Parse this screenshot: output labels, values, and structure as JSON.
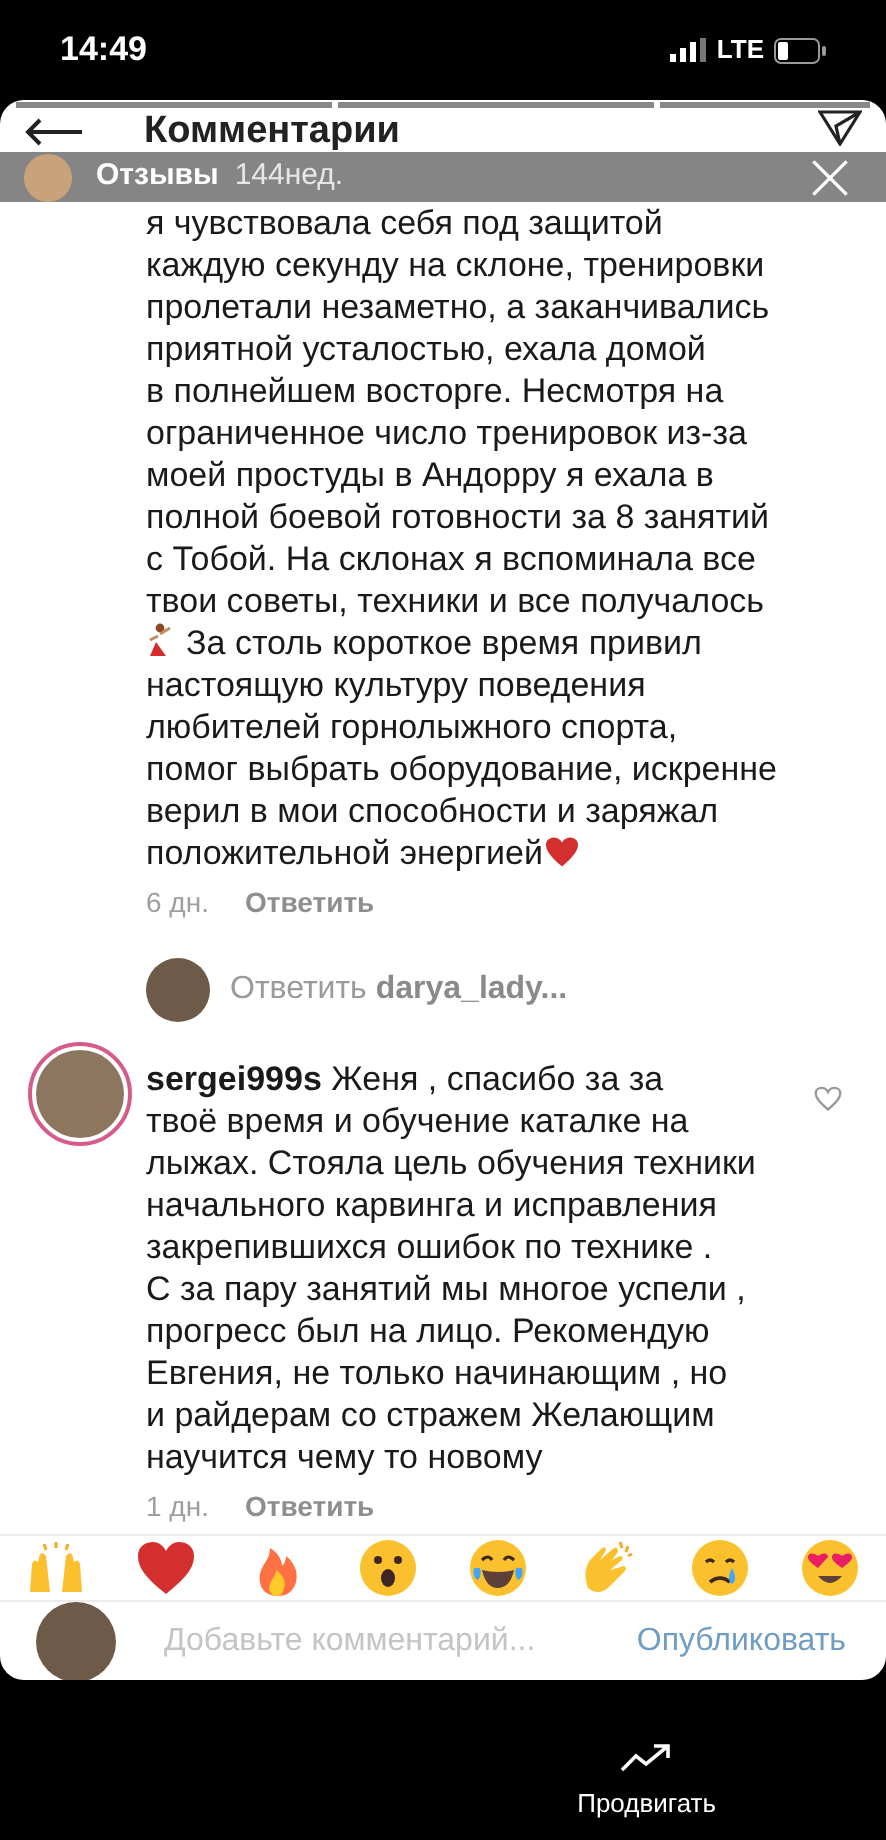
{
  "status_bar": {
    "time": "14:49",
    "network": "LTE"
  },
  "header": {
    "title": "Комментарии"
  },
  "story_overlay": {
    "author": "Отзывы",
    "age": "144нед.",
    "progress": [
      {
        "level": 1
      },
      {
        "level": 1
      },
      {
        "level": 1
      }
    ]
  },
  "comments": [
    {
      "kind": "continued",
      "lines": [
        {
          "text": "я чувствовала себя под защитой"
        },
        {
          "text": "каждую секунду на склоне, тренировки"
        },
        {
          "text": "пролетали незаметно, а заканчивались"
        },
        {
          "text": "приятной усталостью, ехала домой"
        },
        {
          "text": "в полнейшем восторге. Несмотря на"
        },
        {
          "text": "ограниченное число тренировок из-за"
        },
        {
          "text": "моей простуды в Андорру я ехала в"
        },
        {
          "text": "полной боевой готовности за 8 занятий"
        },
        {
          "text": "с Тобой. На склонах я вспоминала все"
        },
        {
          "text": "твои советы, техники и все получалось"
        },
        {
          "text": "За столь короткое время привил",
          "kind": "dancer-start"
        },
        {
          "text": "настоящую культуру поведения"
        },
        {
          "text": "любителей горнолыжного спорта,"
        },
        {
          "text": "помог выбрать оборудование, искренне"
        },
        {
          "text": "верил в мои способности и заряжал"
        },
        {
          "text": "положительной энергией",
          "kind": "heart-end"
        }
      ],
      "age": "6 дн.",
      "reply": "Ответить",
      "reply_prompt": {
        "label": "Ответить",
        "user": "darya_lady..."
      }
    },
    {
      "kind": "full",
      "username": "sergei999s",
      "lines": [
        {
          "text": "Женя , спасибо за за"
        },
        {
          "text": "твоё время и обучение каталке на"
        },
        {
          "text": "лыжах. Стояла цель обучения техники"
        },
        {
          "text": "начального карвинга и исправления"
        },
        {
          "text": "закрепившихся ошибок по технике ."
        },
        {
          "text": "С за пару занятий мы многое успели ,"
        },
        {
          "text": "прогресс был на лицо. Рекомендую"
        },
        {
          "text": "Евгения, не только начинающим , но"
        },
        {
          "text": "и райдерам со стражем  Желающим"
        },
        {
          "text": "научится чему то новому"
        }
      ],
      "age": "1 дн.",
      "reply": "Ответить",
      "liked": false
    }
  ],
  "reactions": [
    {
      "kind": "raised-hands"
    },
    {
      "kind": "heart"
    },
    {
      "kind": "fire"
    },
    {
      "kind": "surprised"
    },
    {
      "kind": "laughing"
    },
    {
      "kind": "clapping"
    },
    {
      "kind": "sad"
    },
    {
      "kind": "heart-eyes"
    }
  ],
  "comment_input": {
    "placeholder": "Добавьте комментарий...",
    "post": "Опубликовать"
  },
  "bottom_bar": {
    "promote": "Продвигать"
  }
}
